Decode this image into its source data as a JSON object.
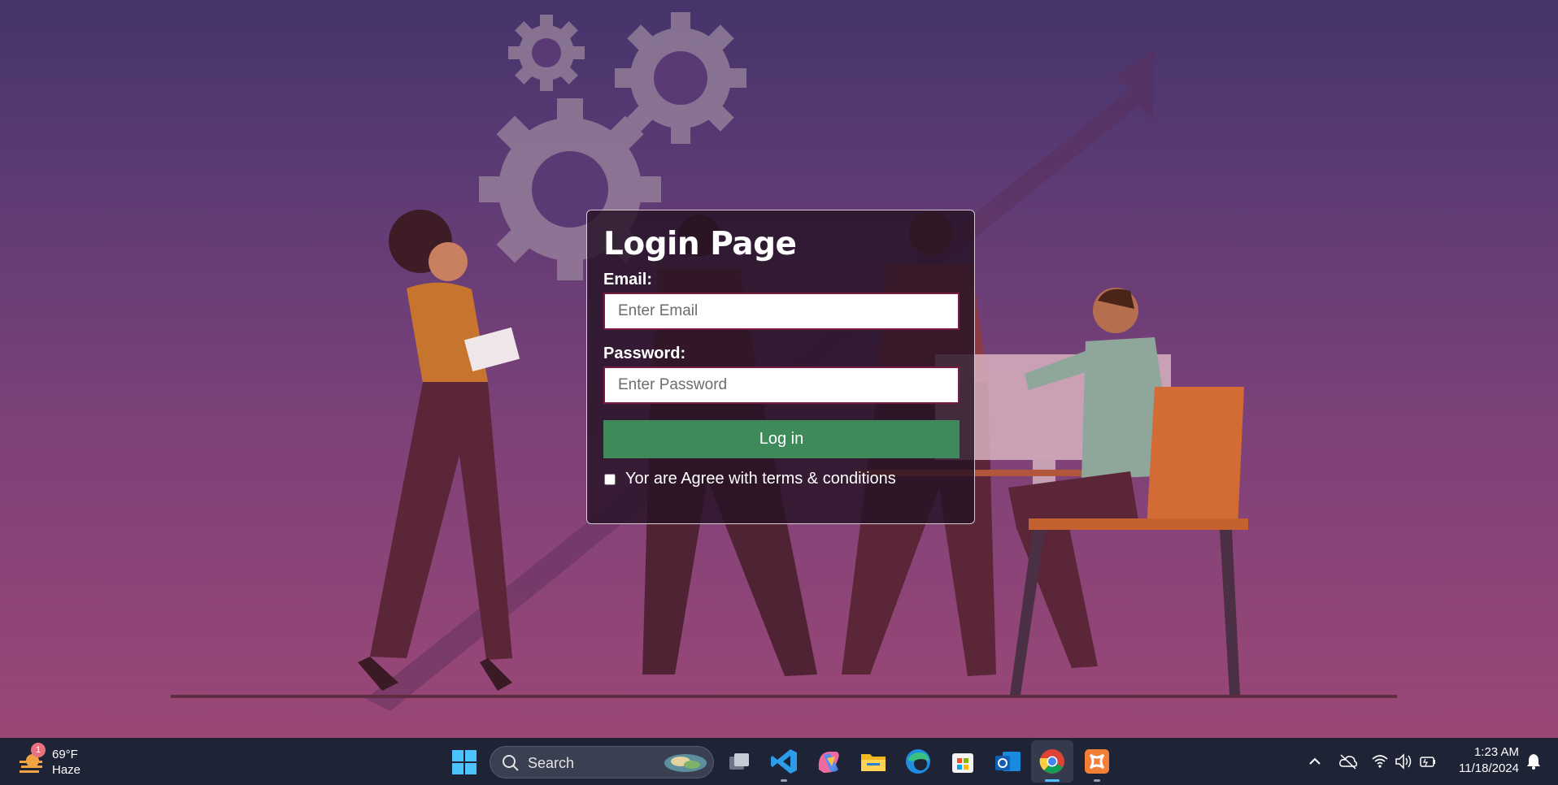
{
  "login": {
    "title": "Login Page",
    "email_label": "Email:",
    "email_placeholder": "Enter Email",
    "email_value": "",
    "password_label": "Password:",
    "password_placeholder": "Enter Password",
    "password_value": "",
    "submit_label": "Log in",
    "terms_label": "Yor are Agree with terms & conditions",
    "terms_checked": false
  },
  "taskbar": {
    "weather": {
      "temperature": "69°F",
      "condition": "Haze",
      "badge": "1"
    },
    "search_label": "Search",
    "pinned_apps": [
      "start-icon",
      "task-view-icon",
      "vscode-icon",
      "copilot-icon",
      "file-explorer-icon",
      "edge-icon",
      "microsoft-store-icon",
      "outlook-icon",
      "chrome-icon",
      "xampp-icon"
    ],
    "active_app": "chrome-icon",
    "tray_icons": [
      "chevron-up-icon",
      "cloud-off-icon",
      "wifi-icon",
      "volume-icon",
      "battery-icon"
    ],
    "clock": {
      "time": "1:23 AM",
      "date": "11/18/2024"
    },
    "notification_icon": "bell-icon"
  },
  "colors": {
    "button_bg": "#3f8a5a",
    "card_bg": "#26122480",
    "input_border": "#7a1b42",
    "taskbar_bg": "#1e2335"
  }
}
